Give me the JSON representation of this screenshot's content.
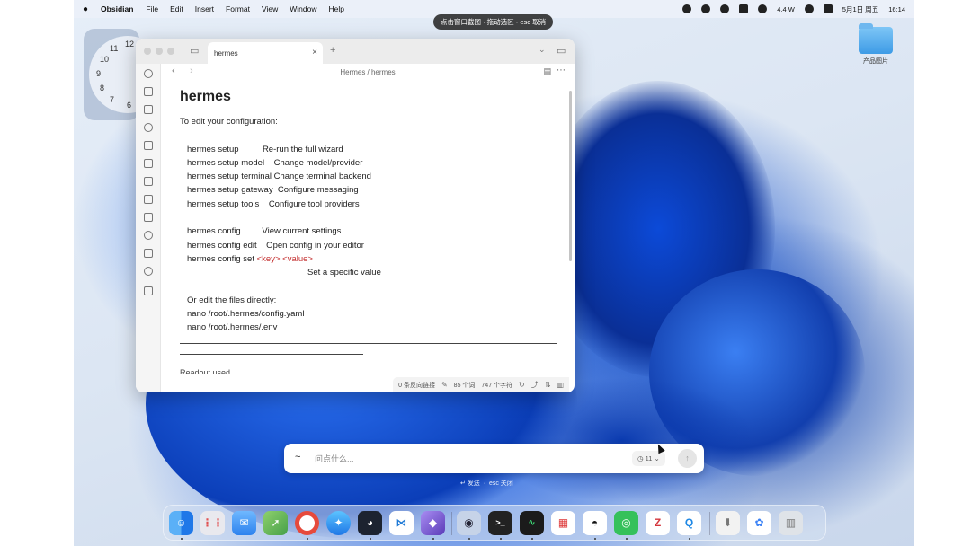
{
  "menubar": {
    "app": "Obsidian",
    "items": [
      "File",
      "Edit",
      "Insert",
      "Format",
      "View",
      "Window",
      "Help"
    ],
    "network": "4.4 W",
    "datetime": "5月1日 周五",
    "time": "16:14"
  },
  "capture_hint": "点击窗口截图 · 拖动选区 · esc 取消",
  "clock_numbers": [
    "12",
    "11",
    "10",
    "9",
    "8",
    "7",
    "6"
  ],
  "desktop_folder": "产品图片",
  "obsidian": {
    "tab_title": "hermes",
    "breadcrumb": "Hermes / hermes",
    "title": "hermes",
    "intro": "To edit your configuration:",
    "lines": [
      "hermes setup          Re-run the full wizard",
      "hermes setup model    Change model/provider",
      "hermes setup terminal Change terminal backend",
      "hermes setup gateway  Configure messaging",
      "hermes setup tools    Configure tool providers"
    ],
    "config_lines": [
      "hermes config         View current settings",
      "hermes config edit    Open config in your editor"
    ],
    "config_set_prefix": "hermes config set ",
    "config_set_key": "<key>",
    "config_set_value": "<value>",
    "config_set_desc": "Set a specific value",
    "files_intro": "Or edit the files directly:",
    "file_lines": [
      "nano /root/.hermes/config.yaml",
      "nano /root/.hermes/.env"
    ],
    "truncated_text": "Readout used",
    "status": {
      "backlinks": "0 条反向链接",
      "words": "85 个词",
      "chars": "747 个字符"
    }
  },
  "ask": {
    "placeholder": "问点什么...",
    "count": "11",
    "hint_send": "↵ 发送",
    "hint_close": "esc 关闭"
  },
  "dock_icons": [
    "finder-icon",
    "launchpad-icon",
    "mail-icon",
    "maps-icon",
    "chrome-icon",
    "safari-icon",
    "app-icon",
    "vscode-icon",
    "obsidian-icon",
    "app2-icon",
    "terminal-icon",
    "activity-monitor-icon",
    "numbers-icon",
    "qq-icon",
    "wechat-icon",
    "zotero-icon",
    "quick-icon",
    "downloads-icon",
    "folder-icon",
    "trash-icon"
  ],
  "colors": {
    "accent_red": "#c43030",
    "desktop_blue": "#1b5de0"
  }
}
